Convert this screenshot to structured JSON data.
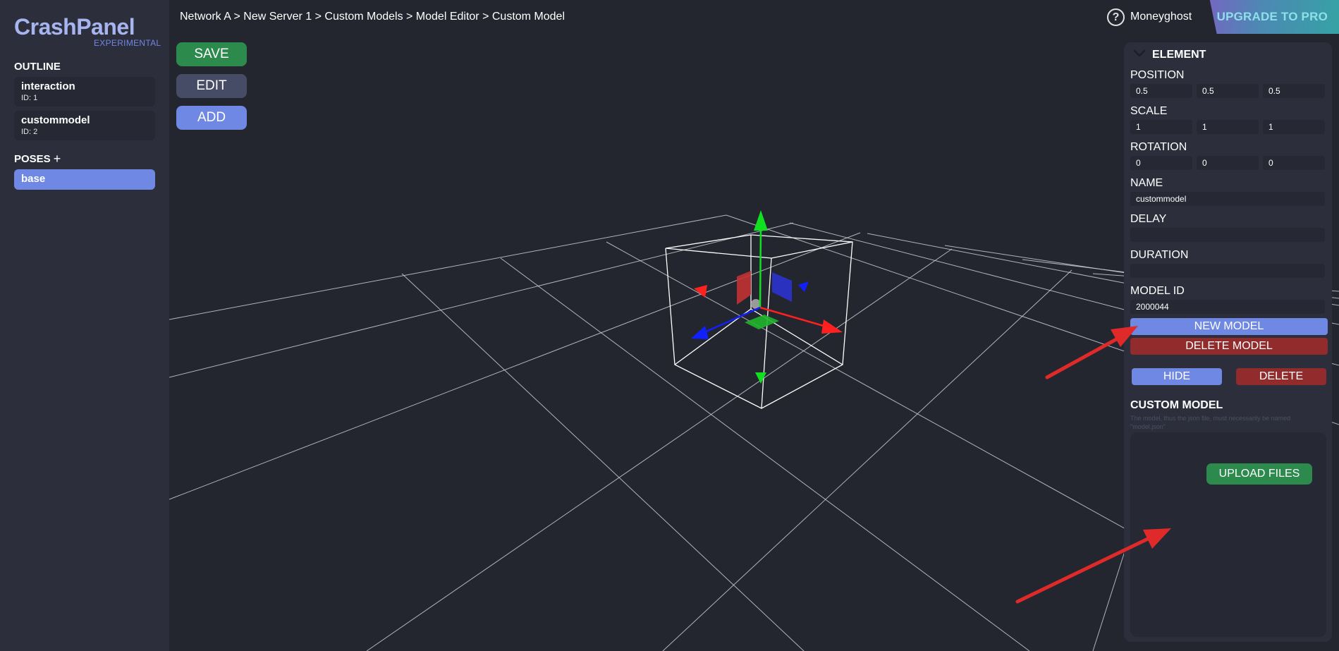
{
  "app": {
    "logo": "CrashPanel",
    "badge": "EXPERIMENTAL"
  },
  "sidebar": {
    "outline_title": "OUTLINE",
    "outline_items": [
      {
        "name": "interaction",
        "id": "ID: 1"
      },
      {
        "name": "custommodel",
        "id": "ID: 2"
      }
    ],
    "poses_title": "POSES",
    "poses_add": "+",
    "poses": [
      {
        "name": "base"
      }
    ]
  },
  "header": {
    "breadcrumb": "Network A > New Server 1 > Custom Models > Model Editor > Custom Model",
    "help": "?",
    "username": "Moneyghost",
    "upgrade": "UPGRADE TO PRO"
  },
  "toolbar": {
    "save": "SAVE",
    "edit": "EDIT",
    "add": "ADD"
  },
  "panel": {
    "title": "ELEMENT",
    "position_label": "POSITION",
    "position": [
      "0.5",
      "0.5",
      "0.5"
    ],
    "scale_label": "SCALE",
    "scale": [
      "1",
      "1",
      "1"
    ],
    "rotation_label": "ROTATION",
    "rotation": [
      "0",
      "0",
      "0"
    ],
    "name_label": "NAME",
    "name_value": "custommodel",
    "delay_label": "DELAY",
    "delay_value": "",
    "duration_label": "DURATION",
    "duration_value": "",
    "model_id_label": "MODEL ID",
    "model_id_value": "2000044",
    "new_model": "NEW MODEL",
    "delete_model": "DELETE MODEL",
    "hide": "HIDE",
    "delete": "DELETE",
    "custom_model_title": "CUSTOM MODEL",
    "custom_model_hint": "The model, thus the json file, must necessarily be named \"model.json\"",
    "upload": "UPLOAD FILES"
  },
  "colors": {
    "background": "#23262f",
    "sidebar": "#2c2f3b",
    "accent_blue": "#6e88e4",
    "green": "#2c8a4d",
    "red": "#922b2b",
    "axis_x": "#ff2020",
    "axis_y": "#10e020",
    "axis_z": "#1020ff",
    "annotation_arrow": "#e02a2a"
  }
}
